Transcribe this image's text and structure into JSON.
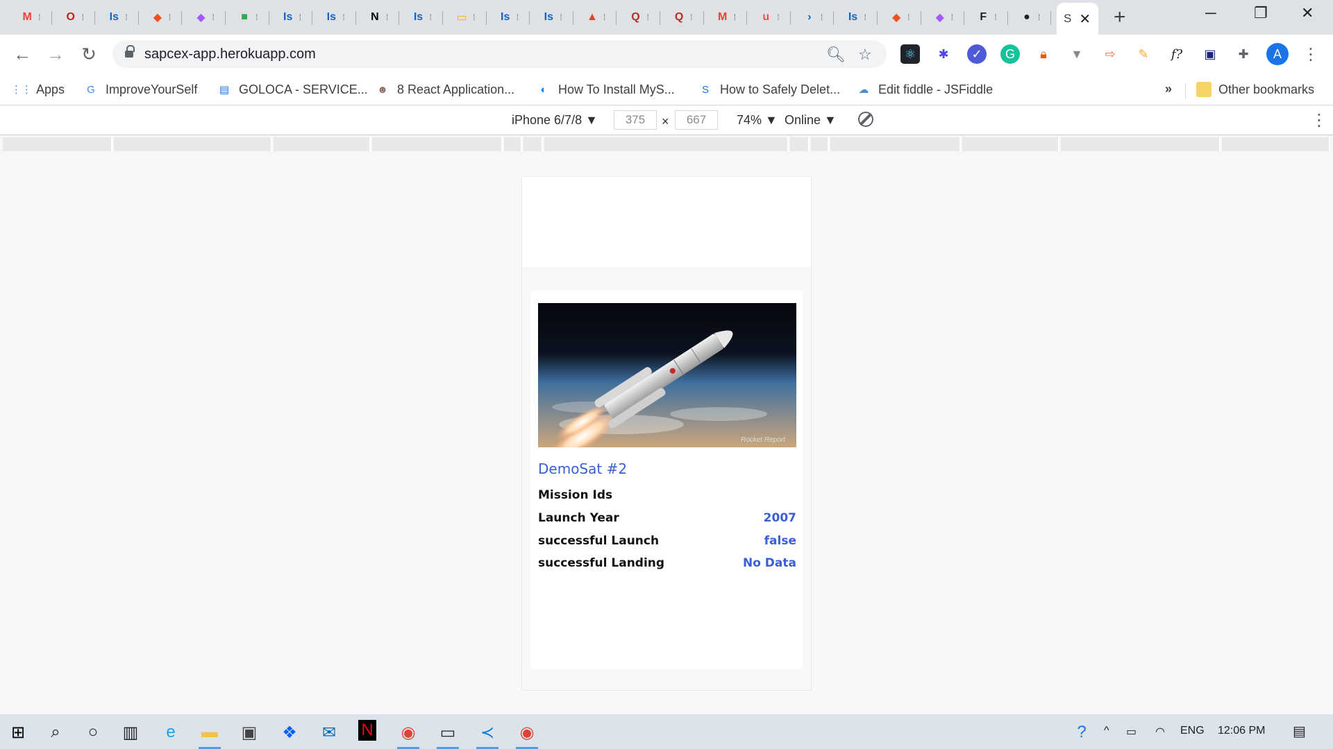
{
  "browser": {
    "tabs": [
      {
        "icon": "gmail-icon",
        "glyph": "M",
        "color": "#ea4335"
      },
      {
        "icon": "opera-icon",
        "glyph": "O",
        "color": "#cc1b1b"
      },
      {
        "icon": "is-icon",
        "glyph": "Is",
        "color": "#1565c0"
      },
      {
        "icon": "figma-icon",
        "glyph": "◆",
        "color": "#f24e1e"
      },
      {
        "icon": "figma-icon",
        "glyph": "◆",
        "color": "#a259ff"
      },
      {
        "icon": "chat-icon",
        "glyph": "■",
        "color": "#34a853"
      },
      {
        "icon": "is-icon",
        "glyph": "Is",
        "color": "#1565c0"
      },
      {
        "icon": "is-icon",
        "glyph": "Is",
        "color": "#1565c0"
      },
      {
        "icon": "notion-icon",
        "glyph": "N",
        "color": "#000000"
      },
      {
        "icon": "is-icon",
        "glyph": "Is",
        "color": "#1565c0"
      },
      {
        "icon": "slides-icon",
        "glyph": "▭",
        "color": "#f4b400"
      },
      {
        "icon": "is-icon",
        "glyph": "Is",
        "color": "#1565c0"
      },
      {
        "icon": "is-icon",
        "glyph": "Is",
        "color": "#1565c0"
      },
      {
        "icon": "gitlab-icon",
        "glyph": "▲",
        "color": "#e24329"
      },
      {
        "icon": "quora-icon",
        "glyph": "Q",
        "color": "#b92b27"
      },
      {
        "icon": "quora-icon",
        "glyph": "Q",
        "color": "#b92b27"
      },
      {
        "icon": "gmail-icon",
        "glyph": "M",
        "color": "#ea4335"
      },
      {
        "icon": "udemy-icon",
        "glyph": "u",
        "color": "#ec5252"
      },
      {
        "icon": "powershell-icon",
        "glyph": "›",
        "color": "#1565c0"
      },
      {
        "icon": "is-icon",
        "glyph": "Is",
        "color": "#1565c0"
      },
      {
        "icon": "figma-icon",
        "glyph": "◆",
        "color": "#f24e1e"
      },
      {
        "icon": "figma-icon",
        "glyph": "◆",
        "color": "#a259ff"
      },
      {
        "icon": "app-icon",
        "glyph": "F",
        "color": "#222222"
      },
      {
        "icon": "github-icon",
        "glyph": "●",
        "color": "#222222"
      }
    ],
    "active_tab": {
      "title": "S",
      "icon": "close-icon"
    },
    "url": "sapcex-app.herokuapp.com"
  },
  "bookmarks": [
    {
      "label": "Apps",
      "icon": "apps-grid-icon",
      "color": "#4285f4",
      "glyph": "⋮⋮"
    },
    {
      "label": "ImproveYourSelf",
      "icon": "translate-icon",
      "color": "#4285f4",
      "glyph": "G"
    },
    {
      "label": "GOLOCA - SERVICE...",
      "icon": "doc-icon",
      "color": "#1a73e8",
      "glyph": "▤"
    },
    {
      "label": "8 React Application...",
      "icon": "avatar-icon",
      "color": "#8d6e63",
      "glyph": "☻"
    },
    {
      "label": "How To Install MyS...",
      "icon": "digitalocean-icon",
      "color": "#0080ff",
      "glyph": "◐"
    },
    {
      "label": "How to Safely Delet...",
      "icon": "js-icon",
      "color": "#1a73e8",
      "glyph": "S"
    },
    {
      "label": "Edit fiddle - JSFiddle",
      "icon": "jsfiddle-icon",
      "color": "#4a90d9",
      "glyph": "☁"
    }
  ],
  "other_bookmarks": "Other bookmarks",
  "more_label": "»",
  "devtools": {
    "device": "iPhone 6/7/8 ▼",
    "width": "375",
    "times": "×",
    "height": "667",
    "zoom": "74% ▼",
    "network": "Online ▼"
  },
  "card": {
    "title": "DemoSat #2",
    "rows": [
      {
        "label": "Mission Ids",
        "value": ""
      },
      {
        "label": "Launch Year",
        "value": "2007"
      },
      {
        "label": "successful Launch",
        "value": "false"
      },
      {
        "label": "successful Landing",
        "value": "No Data"
      }
    ],
    "image_watermark": "Rocket Report"
  },
  "taskbar": {
    "language": "ENG",
    "time": "12:06 PM"
  }
}
